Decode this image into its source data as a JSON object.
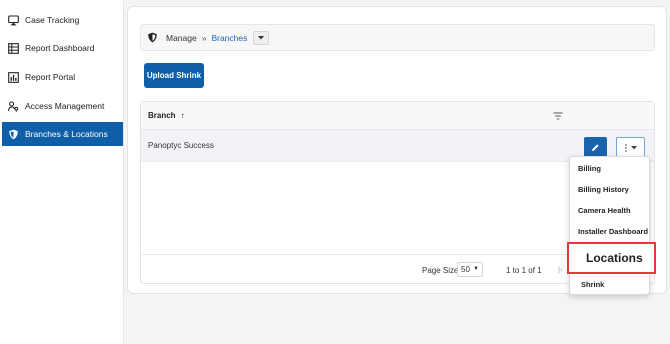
{
  "sidebar": {
    "items": [
      {
        "label": "Case Tracking",
        "icon": "monitor-icon"
      },
      {
        "label": "Report Dashboard",
        "icon": "grid-list-icon"
      },
      {
        "label": "Report Portal",
        "icon": "bar-chart-icon"
      },
      {
        "label": "Access Management",
        "icon": "users-key-icon"
      },
      {
        "label": "Branches & Locations",
        "icon": "shield-icon",
        "active": true
      }
    ]
  },
  "breadcrumb": {
    "root": "Manage",
    "separator": "»",
    "current": "Branches"
  },
  "actions": {
    "upload_label": "Upload Shrink"
  },
  "grid": {
    "column_header": "Branch",
    "sort_indicator": "↑",
    "rows": [
      {
        "branch": "Panoptyc Success"
      }
    ],
    "footer": {
      "page_size_label": "Page Size:",
      "page_size_value": "50",
      "range_text": "1 to 1 of 1",
      "first_page_glyph": "|‹"
    }
  },
  "menu": {
    "items": [
      "Billing",
      "Billing History",
      "Camera Health",
      "Installer Dashboard",
      "Locations",
      "Shrink"
    ],
    "highlighted": "Locations"
  },
  "colors": {
    "accent": "#0f5fa8",
    "highlight_border": "#e53935",
    "link": "#1e63b5"
  }
}
